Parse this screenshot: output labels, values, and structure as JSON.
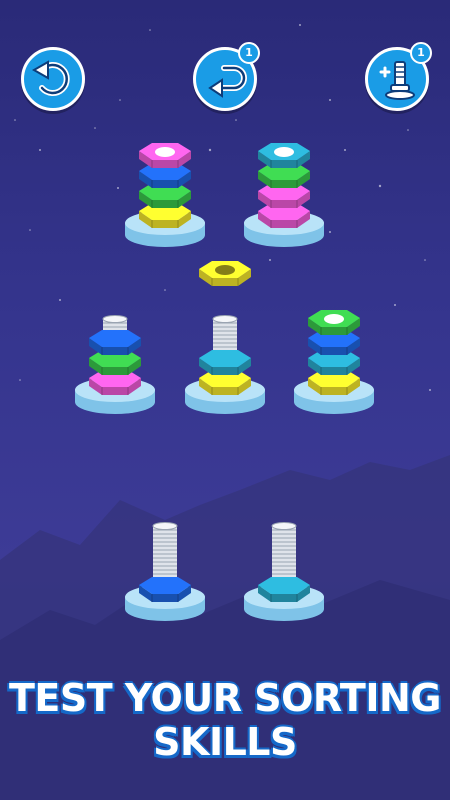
{
  "toolbar": {
    "undo": {
      "icon": "undo-icon",
      "badge": ""
    },
    "redo": {
      "icon": "redo-icon",
      "badge": "1"
    },
    "add_bolt": {
      "icon": "add-bolt-icon",
      "badge": "1"
    }
  },
  "floating_nut": {
    "color": "yellow"
  },
  "stands": [
    {
      "nuts": [
        "yellow",
        "green",
        "blue",
        "pink"
      ],
      "bolt_visible": false
    },
    {
      "nuts": [
        "pink",
        "pink",
        "green",
        "cyan"
      ],
      "bolt_visible": false
    },
    {
      "nuts": [
        "pink",
        "green",
        "blue"
      ],
      "bolt_visible": true
    },
    {
      "nuts": [
        "yellow",
        "cyan"
      ],
      "bolt_visible": true
    },
    {
      "nuts": [
        "yellow",
        "cyan",
        "blue",
        "green"
      ],
      "bolt_visible": false
    },
    {
      "nuts": [
        "blue"
      ],
      "bolt_visible": true
    },
    {
      "nuts": [
        "cyan"
      ],
      "bolt_visible": true
    }
  ],
  "colors": {
    "pink": "#ee5bd6",
    "blue": "#1f66e0",
    "green": "#39c54a",
    "yellow": "#f2e52b",
    "cyan": "#29a9c9",
    "button": "#1a9ce6",
    "banner_shadow": "#1569c9"
  },
  "banner": {
    "line1": "TEST YOUR SORTING",
    "line2": "SKILLS"
  }
}
